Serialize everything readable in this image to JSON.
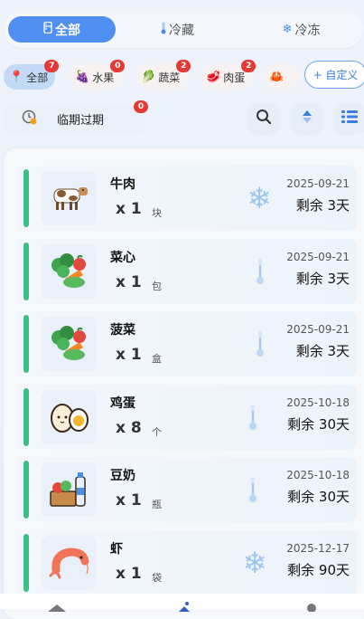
{
  "storage_tabs": [
    {
      "label": "全部",
      "icon": "fridge-icon"
    },
    {
      "label": "冷藏",
      "icon": "thermometer-icon"
    },
    {
      "label": "冷冻",
      "icon": "snowflake-icon"
    }
  ],
  "categories": [
    {
      "label": "全部",
      "icon": "pin-icon",
      "count": "7"
    },
    {
      "label": "水果",
      "icon": "fruit-icon",
      "count": "0"
    },
    {
      "label": "蔬菜",
      "icon": "vegetable-icon",
      "count": "2"
    },
    {
      "label": "肉蛋",
      "icon": "meat-icon",
      "count": "2"
    },
    {
      "label": "",
      "icon": "crab-icon",
      "count": ""
    }
  ],
  "custom_button": "+ 自定义",
  "filter": {
    "expiring_label": "临期过期",
    "expiring_count": "0"
  },
  "items": [
    {
      "name": "牛肉",
      "qty": "x 1",
      "unit": "块",
      "date": "2025-09-21",
      "remaining": "剩余 3天",
      "storage": "frozen",
      "icon": "cow-icon"
    },
    {
      "name": "菜心",
      "qty": "x 1",
      "unit": "包",
      "date": "2025-09-21",
      "remaining": "剩余 3天",
      "storage": "fridge",
      "icon": "vegetables-icon"
    },
    {
      "name": "菠菜",
      "qty": "x 1",
      "unit": "盒",
      "date": "2025-09-21",
      "remaining": "剩余 3天",
      "storage": "fridge",
      "icon": "vegetables-icon"
    },
    {
      "name": "鸡蛋",
      "qty": "x 8",
      "unit": "个",
      "date": "2025-10-18",
      "remaining": "剩余 30天",
      "storage": "fridge",
      "icon": "egg-icon"
    },
    {
      "name": "豆奶",
      "qty": "x 1",
      "unit": "瓶",
      "date": "2025-10-18",
      "remaining": "剩余 30天",
      "storage": "fridge",
      "icon": "grocery-icon"
    },
    {
      "name": "虾",
      "qty": "x 1",
      "unit": "袋",
      "date": "2025-12-17",
      "remaining": "剩余 90天",
      "storage": "frozen",
      "icon": "shrimp-icon"
    }
  ],
  "colors": {
    "accent": "#4f8ff2",
    "fresh_bar": "#3cc08a",
    "badge": "#e53935"
  }
}
